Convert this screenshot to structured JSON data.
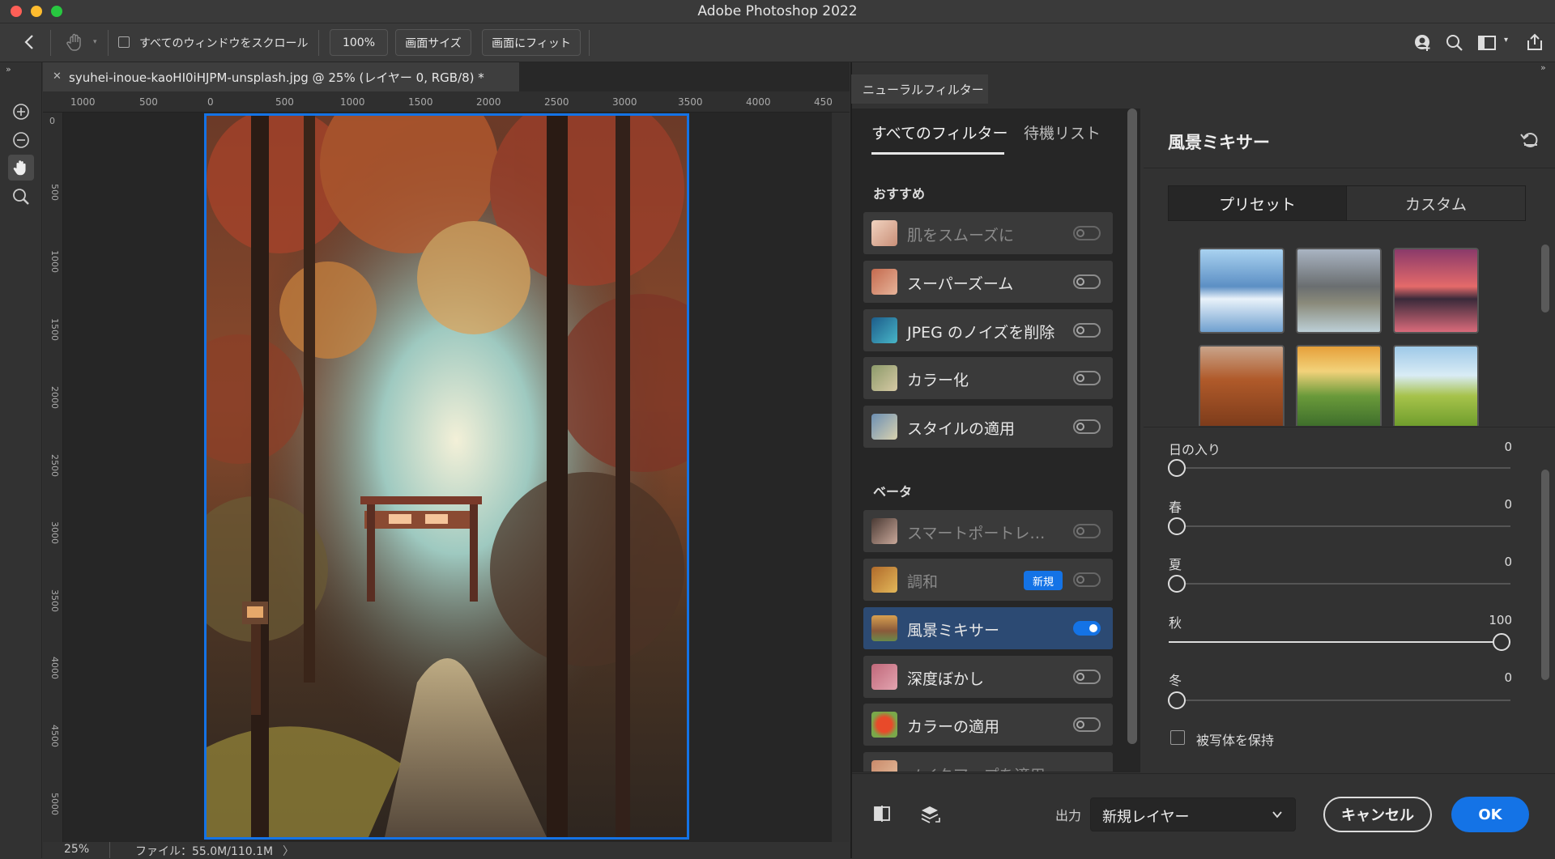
{
  "window": {
    "title": "Adobe Photoshop 2022"
  },
  "options_bar": {
    "scroll_all_label": "すべてのウィンドウをスクロール",
    "zoom_100": "100%",
    "fit_screen_size": "画面サイズ",
    "fit_screen": "画面にフィット"
  },
  "document": {
    "tab_title": "syuhei-inoue-kaoHI0iHJPM-unsplash.jpg @ 25% (レイヤー 0, RGB/8) *",
    "h_ruler": [
      "1000",
      "500",
      "0",
      "500",
      "1000",
      "1500",
      "2000",
      "2500",
      "3000",
      "3500",
      "4000",
      "450"
    ],
    "v_ruler": [
      "0",
      "500",
      "1000",
      "1500",
      "2000",
      "2500",
      "3000",
      "3500",
      "4000",
      "4500",
      "5000"
    ],
    "zoom": "25%",
    "file_info": "ファイル：55.0M/110.1M",
    "status_arrow": "〉"
  },
  "neural_filters": {
    "panel_title": "ニューラルフィルター",
    "tabs": [
      "すべてのフィルター",
      "待機リスト"
    ],
    "recommended_heading": "おすすめ",
    "beta_heading": "ベータ",
    "recommended": [
      {
        "label": "肌をスムーズに",
        "enabled": false,
        "dim": true
      },
      {
        "label": "スーパーズーム",
        "enabled": false,
        "dim": false
      },
      {
        "label": "JPEG のノイズを削除",
        "enabled": false,
        "dim": false
      },
      {
        "label": "カラー化",
        "enabled": false,
        "dim": false
      },
      {
        "label": "スタイルの適用",
        "enabled": false,
        "dim": false
      }
    ],
    "beta": [
      {
        "label": "スマートポートレ…",
        "enabled": false,
        "dim": true
      },
      {
        "label": "調和",
        "enabled": false,
        "dim": true,
        "badge": "新規"
      },
      {
        "label": "風景ミキサー",
        "enabled": true,
        "dim": false,
        "active": true
      },
      {
        "label": "深度ぼかし",
        "enabled": false,
        "dim": false
      },
      {
        "label": "カラーの適用",
        "enabled": false,
        "dim": false
      },
      {
        "label": "メイクアップを適用",
        "enabled": false,
        "dim": true
      }
    ]
  },
  "landscape_mixer": {
    "title": "風景ミキサー",
    "segments": [
      "プリセット",
      "カスタム"
    ],
    "selected_segment": "プリセット",
    "sliders": [
      {
        "label": "日の入り",
        "value": 0
      },
      {
        "label": "春",
        "value": 0
      },
      {
        "label": "夏",
        "value": 0
      },
      {
        "label": "秋",
        "value": 100
      },
      {
        "label": "冬",
        "value": 0
      }
    ],
    "preserve_subject_label": "被写体を保持",
    "preserve_subject": false
  },
  "footer": {
    "output_label": "出力",
    "output_value": "新規レイヤー",
    "cancel_label": "キャンセル",
    "ok_label": "OK"
  },
  "colors": {
    "accent": "#1473e6",
    "active_item": "#2c4a73",
    "panel": "#323232"
  }
}
